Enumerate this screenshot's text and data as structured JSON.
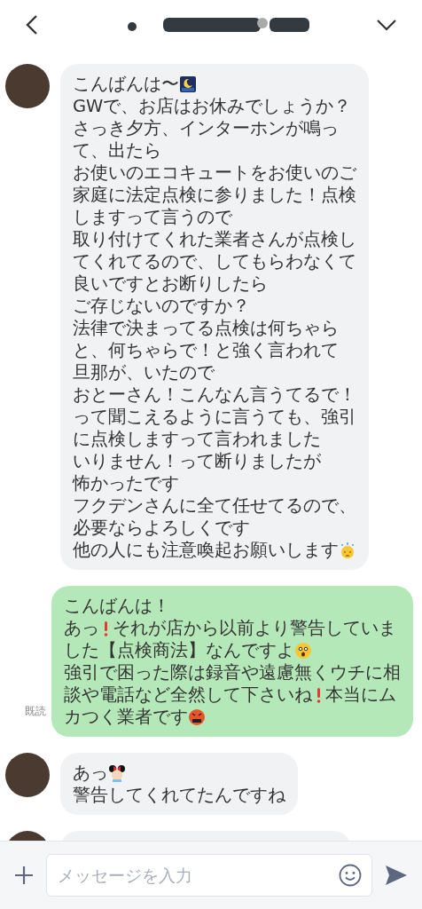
{
  "messages": [
    {
      "kind": "incoming",
      "lines": [
        [
          {
            "kind": "text",
            "text": "こんばんは〜"
          },
          {
            "kind": "night"
          }
        ],
        [
          {
            "kind": "text",
            "text": "GWで、お店はお休みでしょうか？"
          }
        ],
        [
          {
            "kind": "text",
            "text": "さっき夕方、インターホンが鳴っ"
          }
        ],
        [
          {
            "kind": "text",
            "text": "て、出たら"
          }
        ],
        [
          {
            "kind": "text",
            "text": "お使いのエコキュートをお使いのご"
          }
        ],
        [
          {
            "kind": "text",
            "text": "家庭に法定点検に参りました！点検"
          }
        ],
        [
          {
            "kind": "text",
            "text": "しますって言うので"
          }
        ],
        [
          {
            "kind": "text",
            "text": "取り付けてくれた業者さんが点検し"
          }
        ],
        [
          {
            "kind": "text",
            "text": "てくれてるので、してもらわなくて"
          }
        ],
        [
          {
            "kind": "text",
            "text": "良いですとお断りしたら"
          }
        ],
        [
          {
            "kind": "text",
            "text": "ご存じないのですか？"
          }
        ],
        [
          {
            "kind": "text",
            "text": "法律で決まってる点検は何ちゃら"
          }
        ],
        [
          {
            "kind": "text",
            "text": "と、何ちゃらで！と強く言われて"
          }
        ],
        [
          {
            "kind": "text",
            "text": "旦那が、いたので"
          }
        ],
        [
          {
            "kind": "text",
            "text": "おとーさん！こんなん言うてるで！"
          }
        ],
        [
          {
            "kind": "text",
            "text": "って聞こえるように言うても、強引"
          }
        ],
        [
          {
            "kind": "text",
            "text": "に点検しますって言われました"
          }
        ],
        [
          {
            "kind": "text",
            "text": "いりません！って断りましたが"
          }
        ],
        [
          {
            "kind": "text",
            "text": "怖かったです"
          }
        ],
        [
          {
            "kind": "text",
            "text": "フクデンさんに全て任せてるので、"
          }
        ],
        [
          {
            "kind": "text",
            "text": "必要ならよろしくです"
          }
        ],
        [
          {
            "kind": "text",
            "text": "他の人にも注意喚起お願いします"
          },
          {
            "kind": "sweat"
          }
        ]
      ]
    },
    {
      "kind": "outgoing",
      "read": "既読",
      "lines": [
        [
          {
            "kind": "text",
            "text": "こんばんは！"
          }
        ],
        [
          {
            "kind": "text",
            "text": "あっ"
          },
          {
            "kind": "exclaim"
          },
          {
            "kind": "text",
            "text": "それが店から以前より警告していま"
          }
        ],
        [
          {
            "kind": "text",
            "text": "した【点検商法】なんですよ"
          },
          {
            "kind": "astonished"
          }
        ],
        [
          {
            "kind": "text",
            "text": "強引で困った際は録音や遠慮無くウチに相"
          }
        ],
        [
          {
            "kind": "text",
            "text": "談や電話など全然して下さいね"
          },
          {
            "kind": "exclaim"
          },
          {
            "kind": "text",
            "text": "本当にム"
          }
        ],
        [
          {
            "kind": "text",
            "text": "カつく業者です"
          },
          {
            "kind": "angry"
          }
        ]
      ]
    },
    {
      "kind": "incoming",
      "lines": [
        [
          {
            "kind": "text",
            "text": "あっ"
          },
          {
            "kind": "mouse"
          }
        ],
        [
          {
            "kind": "text",
            "text": "警告してくれてたんですね"
          }
        ]
      ]
    },
    {
      "kind": "incoming"
    }
  ],
  "input": {
    "placeholder": "メッセージを入力"
  }
}
